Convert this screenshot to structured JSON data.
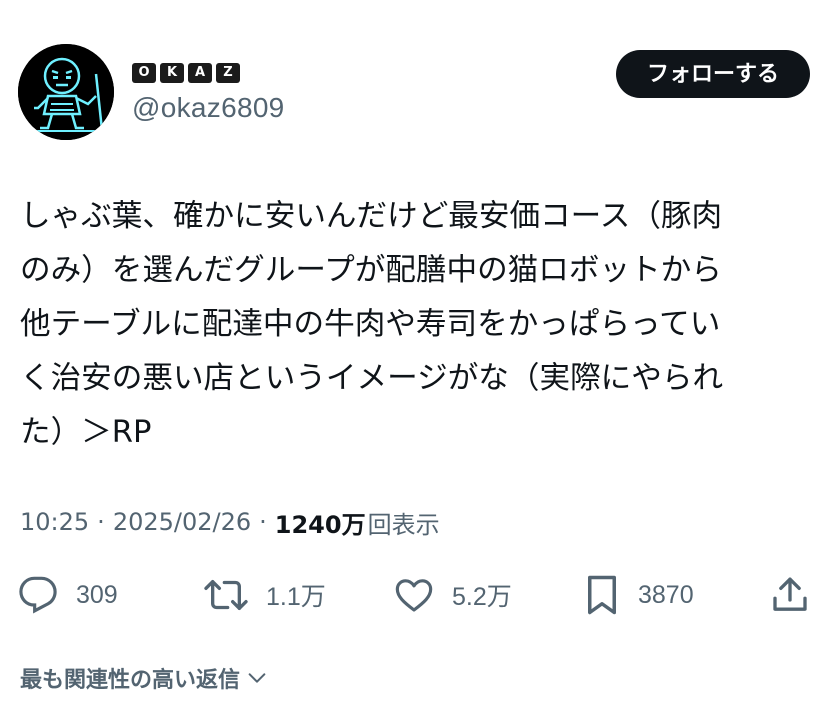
{
  "author": {
    "display_name_letters": [
      "O",
      "K",
      "A",
      "Z"
    ],
    "handle": "@okaz6809",
    "avatar_icon": "pixel-robot-avatar-icon"
  },
  "follow_button_label": "フォローする",
  "tweet": {
    "lines": [
      "しゃぶ葉、確かに安いんだけど最安価コース（豚肉",
      "のみ）を選んだグループが配膳中の猫ロボットから",
      "他テーブルに配達中の牛肉や寿司をかっぱらってい",
      "く治安の悪い店というイメージがな（実際にやられ",
      "た）＞RP"
    ]
  },
  "meta": {
    "time": "10:25",
    "date": "2025/02/26",
    "separator": "·",
    "views_count": "1240万",
    "views_label": "回表示"
  },
  "actions": {
    "reply": {
      "icon": "reply-bubble-icon",
      "count": "309"
    },
    "retweet": {
      "icon": "retweet-icon",
      "count": "1.1万"
    },
    "like": {
      "icon": "heart-icon",
      "count": "5.2万"
    },
    "bookmark": {
      "icon": "bookmark-icon",
      "count": "3870"
    },
    "share": {
      "icon": "share-icon"
    }
  },
  "replies_sort_label": "最も関連性の高い返信",
  "colors": {
    "text_primary": "#0f1419",
    "text_secondary": "#536471",
    "button_bg": "#0f1419",
    "avatar_bg": "#000000",
    "avatar_line": "#6ff0ff"
  }
}
